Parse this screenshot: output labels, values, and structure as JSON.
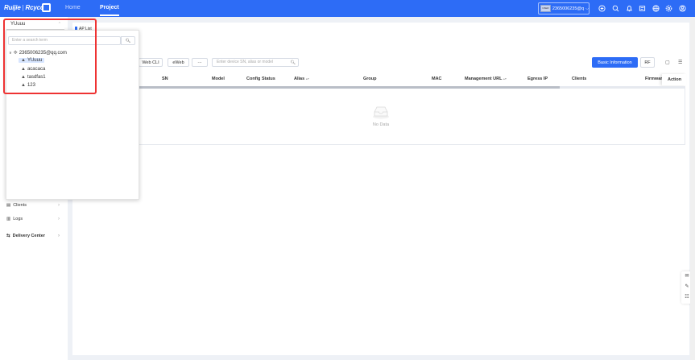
{
  "brand": {
    "name_left": "Ruijie",
    "sep": " | ",
    "name_right": "Rcycc"
  },
  "nav": {
    "home": "Home",
    "project": "Project"
  },
  "account": {
    "avatar_text": "USER",
    "label": "2365006235@q..."
  },
  "icons": {
    "top": [
      "add-circle-icon",
      "search-icon",
      "bell-icon",
      "message-icon",
      "globe-icon",
      "settings-icon",
      "user-icon"
    ],
    "right_float": [
      "chat-icon",
      "edit-icon",
      "clipboard-icon"
    ]
  },
  "project_select": {
    "value": "YUuuu"
  },
  "project_dropdown": {
    "search_placeholder": "Enter a search term",
    "tree": [
      {
        "label": "2365006235@qq.com",
        "level": 0,
        "expanded": true
      },
      {
        "label": "YUuuu",
        "level": 1,
        "selected": true
      },
      {
        "label": "acacaca",
        "level": 1
      },
      {
        "label": "tasdfas1",
        "level": 1
      },
      {
        "label": "123",
        "level": 1
      }
    ]
  },
  "breadcrumb": {
    "tag": "AP List"
  },
  "toolbar": {
    "web_cli": "Web CLI",
    "eweb": "eWeb",
    "more": "···",
    "search_placeholder": "Enter device SN, alias or model",
    "basic_info": "Basic Information",
    "rf": "RF"
  },
  "table": {
    "columns": [
      "SN",
      "Model",
      "Config Status",
      "Alias",
      "Group",
      "MAC",
      "Management URL",
      "Egress IP",
      "Clients",
      "Firmware"
    ],
    "action": "Action",
    "scroll_fraction": 0.77,
    "empty_text": "No Data"
  },
  "sidebar": {
    "items": [
      {
        "label": "Clients",
        "icon": "clients-icon"
      },
      {
        "label": "Logs",
        "icon": "logs-icon"
      },
      {
        "label": "Delivery Center",
        "icon": "delivery-icon"
      }
    ]
  },
  "colors": {
    "primary": "#2d6cf6",
    "highlight": "#e33333"
  }
}
